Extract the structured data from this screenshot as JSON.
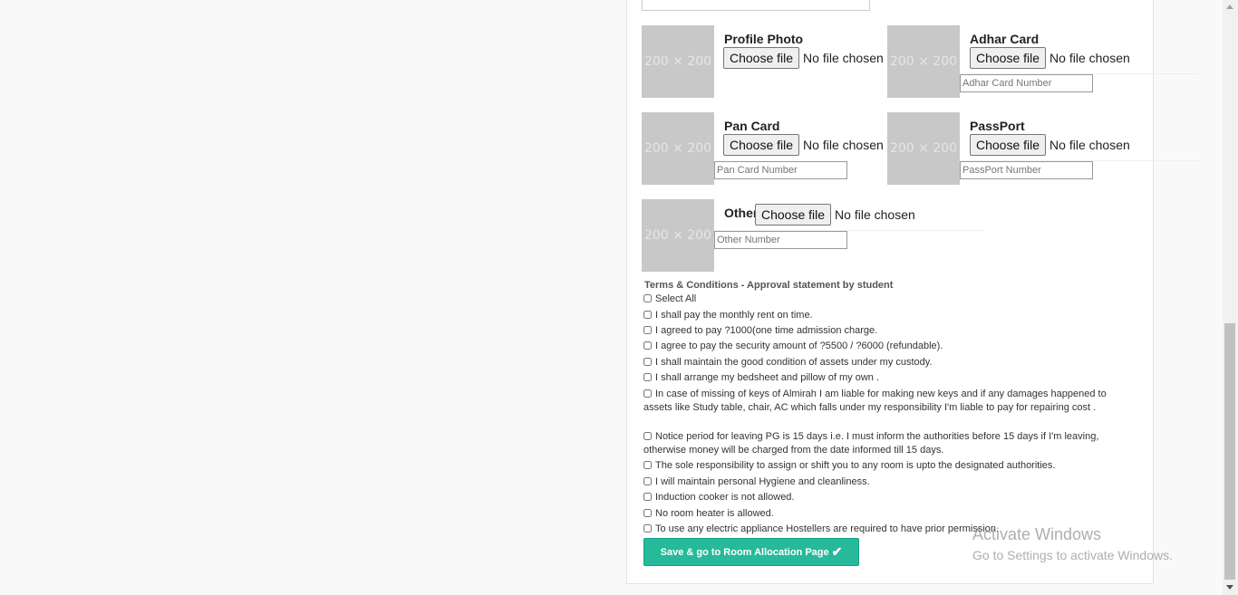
{
  "thumb_text": "200 × 200",
  "file": {
    "button": "Choose file",
    "status": "No file chosen"
  },
  "docs": {
    "profile": {
      "label": "Profile Photo"
    },
    "adhar": {
      "label": "Adhar Card",
      "placeholder": "Adhar Card Number"
    },
    "pan": {
      "label": "Pan Card",
      "placeholder": "Pan Card Number"
    },
    "passport": {
      "label": "PassPort",
      "placeholder": "PassPort Number"
    },
    "other": {
      "label": "Other",
      "placeholder": "Other Number"
    }
  },
  "terms": {
    "title": "Terms & Conditions - Approval statement by student",
    "select_all": "Select All",
    "items": [
      "I shall pay the monthly rent on time.",
      "I agreed to pay ?1000(one time admission charge.",
      "I agree to pay the security amount of ?5500 / ?6000 (refundable).",
      "I shall maintain the good condition of assets under my custody.",
      "I shall arrange my bedsheet and pillow of my own .",
      "In case of missing of keys of Almirah I am liable for making new keys and if any damages happened to assets like Study table, chair, AC which falls under my responsibility I'm liable to pay for repairing cost .",
      "Notice period for leaving PG is 15 days i.e. I must inform the authorities before 15 days if I'm leaving, otherwise money will be charged from the date informed till 15 days.",
      "The sole responsibility to assign or shift you to any room is upto the designated authorities.",
      "I will maintain personal Hygiene and cleanliness.",
      "Induction cooker is not allowed.",
      "No room heater is allowed.",
      "To use any electric appliance Hostellers are required to have prior permission."
    ]
  },
  "save_button": {
    "label": "Save & go to Room Allocation Page",
    "icon": "✔"
  },
  "watermark": {
    "title": "Activate Windows",
    "subtitle": "Go to Settings to activate Windows."
  },
  "colors": {
    "accent": "#26b99a",
    "thumb": "#c8c8c8"
  }
}
